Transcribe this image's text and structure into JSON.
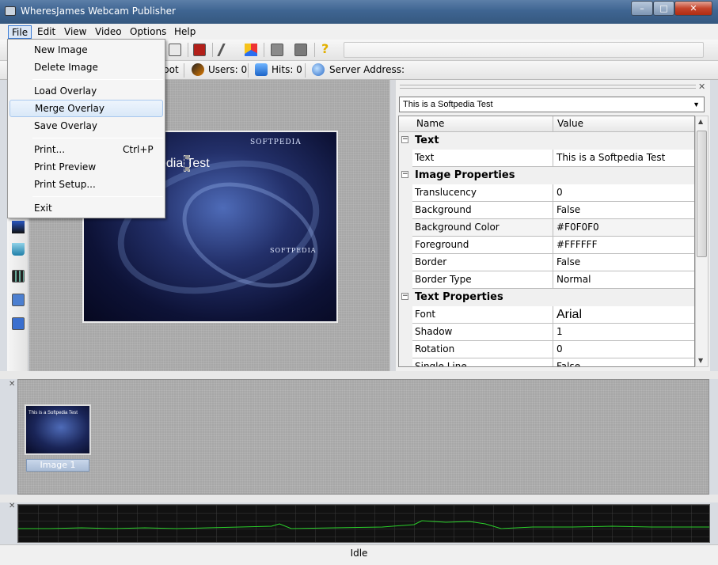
{
  "window": {
    "title": "WheresJames Webcam Publisher",
    "min": "–",
    "max": "□",
    "close": "✕"
  },
  "menubar": [
    "File",
    "Edit",
    "View",
    "Video",
    "Options",
    "Help"
  ],
  "file_menu": {
    "items": [
      {
        "label": "New Image",
        "shortcut": ""
      },
      {
        "label": "Delete Image",
        "shortcut": ""
      },
      {
        "label": "Load Overlay",
        "shortcut": ""
      },
      {
        "label": "Merge Overlay",
        "shortcut": ""
      },
      {
        "label": "Save Overlay",
        "shortcut": ""
      },
      {
        "label": "Print...",
        "shortcut": "Ctrl+P"
      },
      {
        "label": "Print Preview",
        "shortcut": ""
      },
      {
        "label": "Print Setup...",
        "shortcut": ""
      },
      {
        "label": "Exit",
        "shortcut": ""
      }
    ],
    "highlighted": "Merge Overlay"
  },
  "toolbar2": {
    "snapshot_partial": "pot",
    "users": "Users: 0",
    "hits": "Hits: 0",
    "server_address": "Server Address:"
  },
  "canvas": {
    "caption_visible": "edia Test",
    "brand": "SOFTPEDIA"
  },
  "properties": {
    "object_selector": "This is a Softpedia Test",
    "col_name": "Name",
    "col_value": "Value",
    "rows": [
      {
        "type": "cat",
        "name": "Text",
        "value": ""
      },
      {
        "type": "prop",
        "name": "Text",
        "value": "This is a Softpedia Test"
      },
      {
        "type": "cat",
        "name": "Image Properties",
        "value": ""
      },
      {
        "type": "prop",
        "name": "Translucency",
        "value": "0"
      },
      {
        "type": "prop",
        "name": "Background",
        "value": "False"
      },
      {
        "type": "prop",
        "name": "Background Color",
        "value": "#F0F0F0"
      },
      {
        "type": "prop",
        "name": "Foreground",
        "value": "#FFFFFF"
      },
      {
        "type": "prop",
        "name": "Border",
        "value": "False"
      },
      {
        "type": "prop",
        "name": "Border Type",
        "value": "Normal"
      },
      {
        "type": "cat",
        "name": "Text Properties",
        "value": ""
      },
      {
        "type": "prop",
        "name": "Font",
        "value": "Arial"
      },
      {
        "type": "prop",
        "name": "Shadow",
        "value": "1"
      },
      {
        "type": "prop",
        "name": "Rotation",
        "value": "0"
      },
      {
        "type": "prop",
        "name": "Single Line",
        "value": "False"
      }
    ]
  },
  "thumbnail": {
    "label": "Image 1",
    "caption": "This is a Softpedia Test"
  },
  "status": "Idle",
  "colors": {
    "graph_line": "#2bd02b",
    "menu_highlight": "#d9e8f8"
  }
}
